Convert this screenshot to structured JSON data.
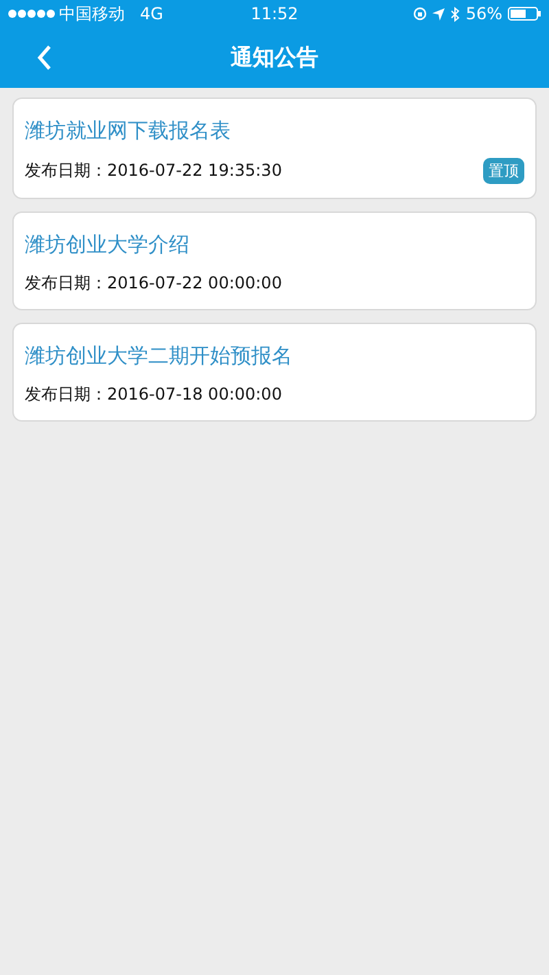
{
  "status_bar": {
    "carrier": "中国移动",
    "network": "4G",
    "time": "11:52",
    "battery": "56%"
  },
  "nav": {
    "title": "通知公告"
  },
  "notices": [
    {
      "title": "潍坊就业网下载报名表",
      "date": "发布日期：2016-07-22 19:35:30",
      "badge": "置顶"
    },
    {
      "title": "潍坊创业大学介绍",
      "date": "发布日期：2016-07-22 00:00:00"
    },
    {
      "title": "潍坊创业大学二期开始预报名",
      "date": "发布日期：2016-07-18 00:00:00"
    }
  ]
}
